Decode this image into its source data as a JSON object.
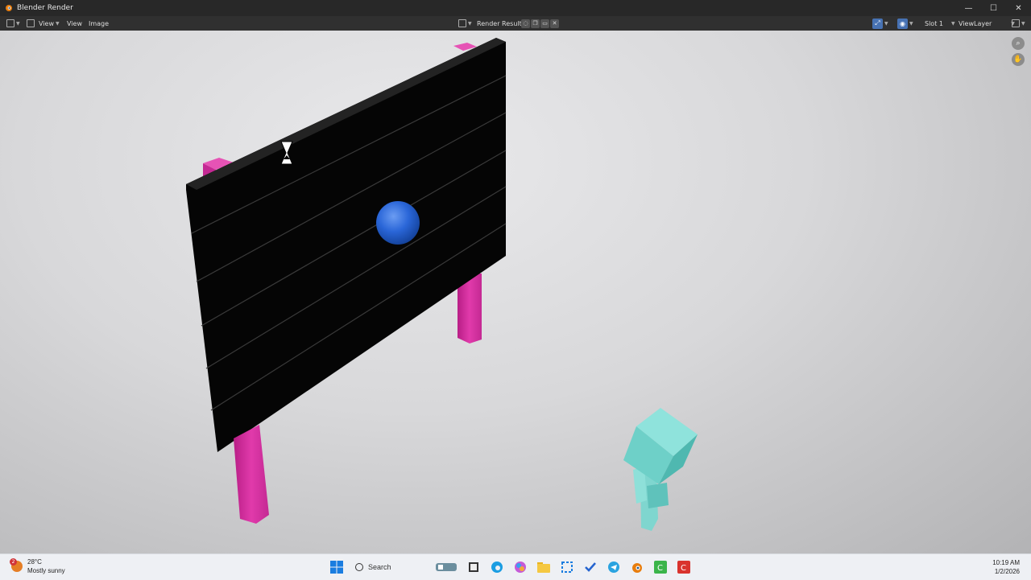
{
  "window": {
    "title": "Blender Render",
    "controls": {
      "minimize": "—",
      "maximize": "☐",
      "close": "✕"
    }
  },
  "header": {
    "menus": [
      "View",
      "Image"
    ],
    "image_name": "Render Result",
    "slot": "Slot 1",
    "view_layer": "ViewLayer"
  },
  "taskbar": {
    "weather": {
      "temp": "28°C",
      "condition": "Mostly sunny",
      "badge": "2"
    },
    "search_label": "Search",
    "apps": [
      "start-icon",
      "search",
      "file-manager-icon",
      "task-view-icon",
      "edge-icon",
      "copilot-icon",
      "explorer-icon",
      "snipping-tool-icon",
      "todo-icon",
      "telegram-icon",
      "blender-icon",
      "camtasia-icon",
      "camtasia-recorder-icon"
    ],
    "time": "10:19 AM",
    "date": "1/2/2026"
  },
  "colors": {
    "board": "#060606",
    "posts": "#d42c9e",
    "ball": "#2a66d8",
    "robot": "#6fd0c8",
    "floor": "#d6d6d8"
  }
}
